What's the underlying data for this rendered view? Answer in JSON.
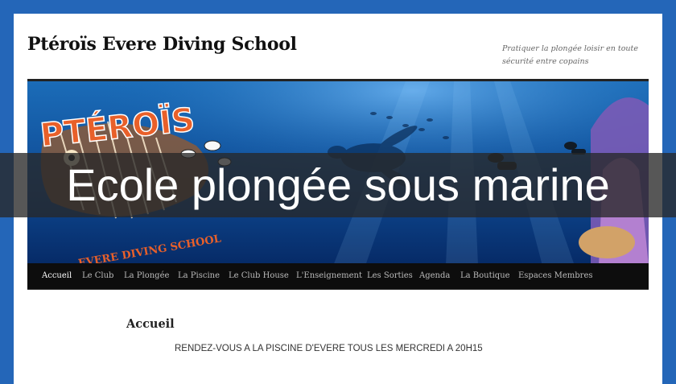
{
  "site": {
    "title": "Ptéroïs Evere Diving School",
    "tagline": "Pratiquer la plongée loisir en toute sécurité entre copains"
  },
  "banner": {
    "logo_text": "PTÉROÏS",
    "logo_subtitle": "EVERE DIVING SCHOOL",
    "colors": {
      "water_top": "#1b5fa8",
      "water_bottom": "#062a66",
      "logo": "#e8602a"
    }
  },
  "nav": {
    "items": [
      {
        "label": "Accueil",
        "active": true
      },
      {
        "label": "Le Club"
      },
      {
        "label": "La Plongée"
      },
      {
        "label": "La Piscine"
      },
      {
        "label": "Le Club House"
      },
      {
        "label": "L'Enseignement"
      },
      {
        "label": "Les Sorties"
      },
      {
        "label": "Agenda"
      },
      {
        "label": "La Boutique"
      },
      {
        "label": "Espaces Membres"
      }
    ]
  },
  "content": {
    "heading": "Accueil",
    "text": "RENDEZ-VOUS A LA PISCINE D'EVERE TOUS LES MERCREDI A 20H15"
  },
  "overlay": {
    "caption": "Ecole plongée sous marine"
  }
}
